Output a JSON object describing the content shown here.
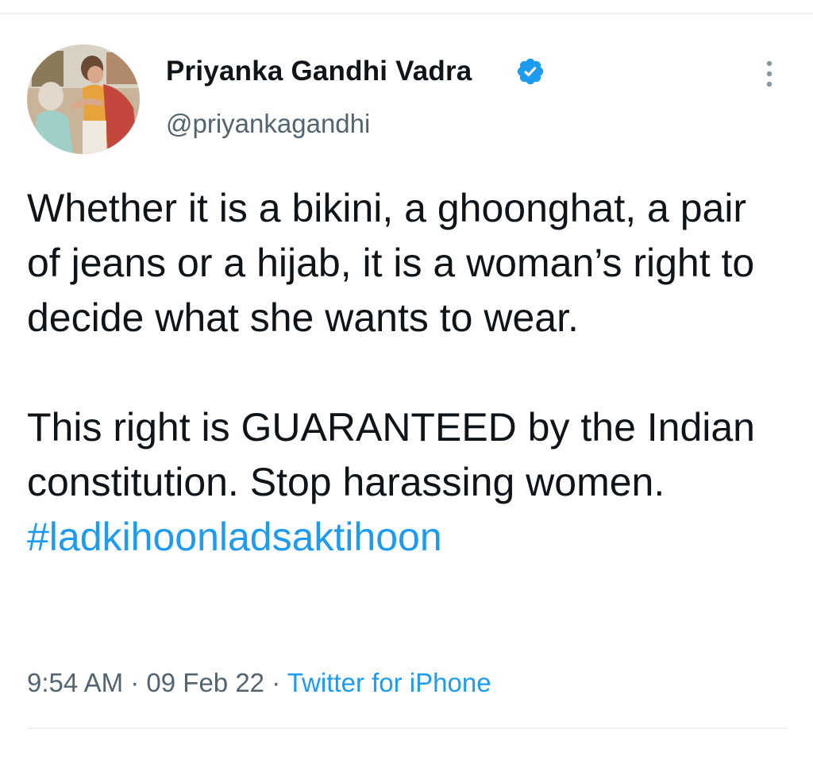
{
  "author": {
    "display_name": "Priyanka Gandhi Vadra",
    "handle": "@priyankagandhi",
    "verified": true
  },
  "tweet": {
    "paragraph_1": "Whether it is a bikini, a ghoonghat, a pair of jeans or a hijab, it is a woman’s right to decide what she wants to wear.",
    "paragraph_2_text": "This right is GUARANTEED by the Indian constitution. Stop harassing women. ",
    "hashtag": "#ladkihoonladsaktihoon"
  },
  "meta": {
    "time": "9:54 AM",
    "separator_1": " · ",
    "date": "09 Feb 22",
    "separator_2": " · ",
    "source": "Twitter for iPhone"
  },
  "icons": {
    "verified": "verified-badge-icon",
    "more": "more-vertical-icon"
  },
  "colors": {
    "accent": "#1d9bf0",
    "text": "#0f1419",
    "secondary": "#536471"
  }
}
